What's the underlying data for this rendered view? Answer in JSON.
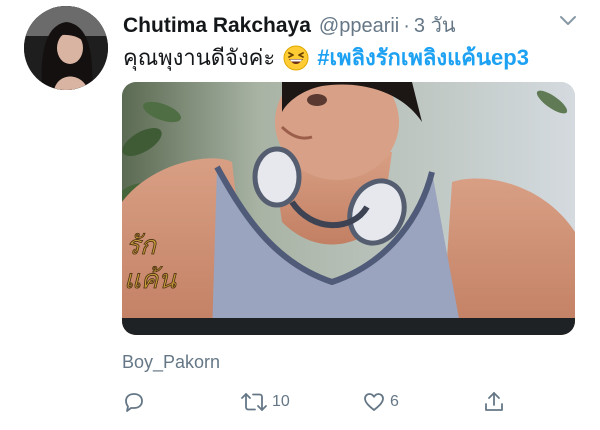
{
  "tweet": {
    "display_name": "Chutima Rakchaya",
    "handle": "@ppearii",
    "separator": "·",
    "timestamp": "3 วัน",
    "text_before_emoji": "คุณพุงานดีจังค่ะ",
    "emoji": "grinning-squinting-face",
    "hashtag": "#เพลิงรักเพลิงแค้นep3",
    "media_caption": "Boy_Pakorn",
    "watermark_logo": "รักแค้น"
  },
  "actions": {
    "reply_icon": "reply-icon",
    "retweet_icon": "retweet-icon",
    "retweet_count": "10",
    "like_icon": "heart-icon",
    "like_count": "6",
    "share_icon": "share-icon"
  },
  "colors": {
    "text": "#14171a",
    "secondary": "#657786",
    "link": "#1da1f2",
    "background": "#ffffff"
  }
}
